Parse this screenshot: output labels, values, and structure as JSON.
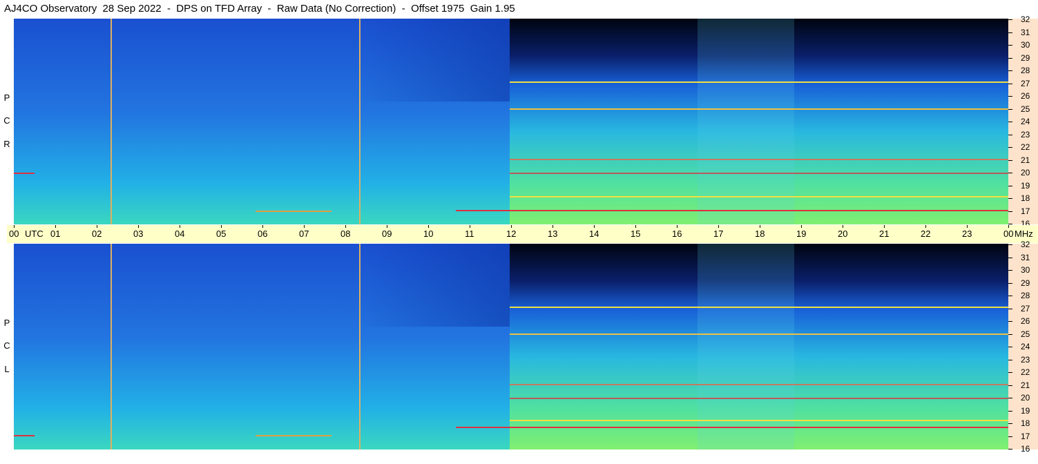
{
  "title": "AJ4CO Observatory  28 Sep 2022  -  DPS on TFD Array  -  Raw Data (No Correction)  -  Offset 1975  Gain 1.95",
  "panels": {
    "top": {
      "polarization_letters": [
        "P",
        "C",
        "R"
      ]
    },
    "bottom": {
      "polarization_letters": [
        "P",
        "C",
        "L"
      ]
    }
  },
  "freq_labels": [
    "32",
    "31",
    "30",
    "29",
    "28",
    "27",
    "26",
    "25",
    "24",
    "23",
    "22",
    "21",
    "20",
    "19",
    "18",
    "17",
    "16"
  ],
  "time_labels": [
    "00",
    "01",
    "02",
    "03",
    "04",
    "05",
    "06",
    "07",
    "08",
    "09",
    "10",
    "11",
    "12",
    "13",
    "14",
    "15",
    "16",
    "17",
    "18",
    "19",
    "20",
    "21",
    "22",
    "23",
    "00"
  ],
  "time_unit": "UTC",
  "freq_unit": "MHz",
  "colors": {
    "axis_background": "#ffffc8",
    "freq_background": "#fde3cb",
    "daytime_blue": "#1e5ad2",
    "night_black": "#000514",
    "interference_yellow": "#f0e040",
    "interference_red": "#e03040"
  }
}
